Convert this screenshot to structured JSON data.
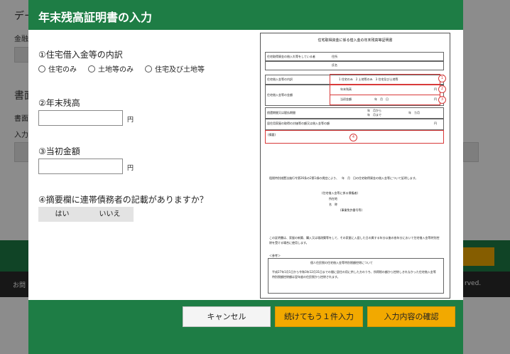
{
  "background": {
    "frag_de": "デー",
    "frag_kin": "金融",
    "frag_sho": "書面",
    "frag_sho2": "書面",
    "frag_nyu": "入力",
    "frag_toi": "お問",
    "frag_copy": "rved."
  },
  "modal": {
    "title": "年末残高証明書の入力",
    "q1": "①住宅借入金等の内訳",
    "q1_options": [
      "住宅のみ",
      "土地等のみ",
      "住宅及び土地等"
    ],
    "q2": "②年末残高",
    "q2_unit": "円",
    "q3": "③当初金額",
    "q3_unit": "円",
    "q4": "④摘要欄に連帯債務者の記載がありますか？",
    "q4_yes": "はい",
    "q4_no": "いいえ",
    "buttons": {
      "cancel": "キャンセル",
      "continue": "続けてもう１件入力",
      "confirm": "入力内容の確認"
    },
    "colors": {
      "header": "#1e7d45",
      "accent": "#f2a900",
      "highlight": "#d83a3a"
    }
  },
  "document": {
    "title": "住宅取得資金に係る借入金の年末残高等証明書",
    "row1_label": "住宅取得資金の借入れ等をしている者",
    "row1_addr": "住所",
    "row1_name": "氏名",
    "row2_label": "住宅借入金等の内訳",
    "row2_options": "1 住宅のみ　2 土地等のみ　3 住宅及び土地等",
    "row3_label": "住宅借入金等の金額",
    "row3_a": "年末残高",
    "row3_b": "当初金額",
    "row3_date": "年　月　日",
    "row4_label": "償還期間又は賦払期間",
    "row4_from": "年　月から",
    "row4_to": "年　月まで",
    "row4_years": "年　カ月",
    "row5_label": "居住用家屋の取得の対価等の額又は借入金等の額",
    "yen": "円",
    "remarks": "(摘要)",
    "badges": [
      "1",
      "2",
      "3",
      "4"
    ],
    "body_text": "租税特別措置法施行令第26条の2第1項の規定により、　年　月　日の住宅取得資金の借入金等について証明します。",
    "issuer_heading": "(住宅借入金等に係る債権者)",
    "issuer_addr": "所在地",
    "issuer_name": "名　称",
    "issuer_reg": "(事業免許番号等)",
    "notes": "この証明書は、家屋の新築、購入又は増改築等をして、その家屋に入居した日の属する年分以後の各年分において住宅借入金等特別控除を受ける場合に使用します。",
    "box_heading": "個人住民税の住宅借入金等特別税額控除について",
    "box_text": "平成27年1月1日から令和3年12月31日までの間に居住の用に供した方のうち、所得税の額から控除しきれなかった住宅借入金等特別税額控除額は翌年度の住民税から控除されます。",
    "ref": "＜参考＞"
  }
}
